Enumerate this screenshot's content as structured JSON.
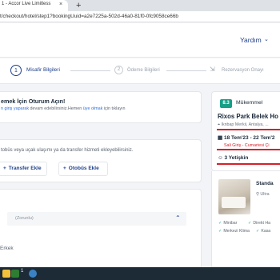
{
  "browser": {
    "tab_title": "1 - Accor Live Limitless",
    "tab_close": "×",
    "new_tab": "+",
    "url": "t/checkout/hotel/step1?bookingUuid=a2e7225a-502d-46a0-81f0-0fc9058ce66b"
  },
  "header": {
    "help_label": "Yardım",
    "help_chevron": "⌄"
  },
  "steps": [
    {
      "number": "1",
      "label": "Misafir Bilgileri"
    },
    {
      "number": "2",
      "label": "Ödeme Bilgileri"
    },
    {
      "number": "",
      "label": "Rezervasyon Onayı"
    }
  ],
  "login": {
    "title": "emek İçin Oturum Açın!",
    "text_link": "n giriş yaparak",
    "text_mid": " devam edebilirsiniz.Hemen ",
    "text_link2": "üye olmak",
    "text_end": " için tıklayın"
  },
  "transfer": {
    "text": "tobüs veya uçak ulaşımı ya da transfer hizmeti ekleyebilirsiniz.",
    "add_transfer": "Transfer Ekle",
    "add_bus": "Otobüs Ekle",
    "plus": "+"
  },
  "guest": {
    "required_label": "(Zorunlu)",
    "chevron": "⌃",
    "gender": "Erkek"
  },
  "hotel": {
    "score": "8.3",
    "score_label": "Mükemmel",
    "name": "Rixos Park Belek Ho",
    "location": "Iknbap Merkii, Antalya, ...",
    "dates": "18 Tem'23 - 22 Tem'2",
    "checkin": "Sali Giriş - Cumartesi Çi",
    "guests": "3 Yetişkin",
    "colors": {
      "score_bg": "#16a085",
      "highlight": "#d8202a",
      "brand": "#1d3f8c"
    }
  },
  "room": {
    "name": "Standa",
    "sub": "Ultra",
    "amenities": [
      "Minibar",
      "Direkt Ha",
      "Merkezi Klima",
      "Kasa"
    ]
  },
  "taskbar": {
    "badge": "1"
  }
}
